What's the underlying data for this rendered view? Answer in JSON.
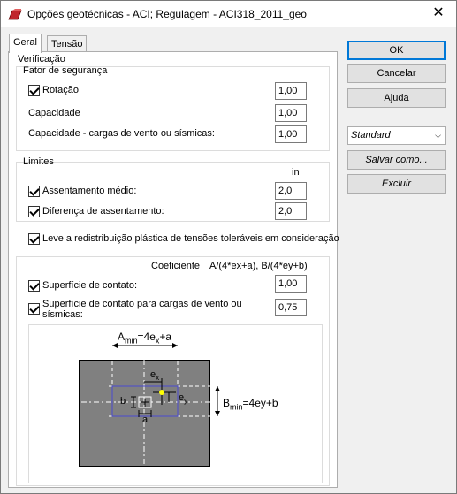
{
  "window": {
    "title": "Opções geotécnicas - ACI;  Regulagem - ACI318_2011_geo",
    "close": "✕"
  },
  "tabs": [
    {
      "label": "Geral",
      "active": true
    },
    {
      "label": "Tensão",
      "active": false
    }
  ],
  "verificacao": {
    "title": "Verificação",
    "fator": {
      "title": "Fator de segurança",
      "rows": [
        {
          "label": "Rotação",
          "value": "1,00",
          "checked": true
        },
        {
          "label": "Capacidade",
          "value": "1,00"
        },
        {
          "label": "Capacidade - cargas de vento ou sísmicas:",
          "value": "1,00"
        }
      ]
    }
  },
  "limites": {
    "title": "Limites",
    "unit": "in",
    "rows": [
      {
        "label": "Assentamento médio:",
        "value": "2,0",
        "checked": true
      },
      {
        "label": "Diferença de assentamento:",
        "value": "2,0",
        "checked": true
      }
    ]
  },
  "redistribuicao": {
    "label": "Leve a redistribuição plástica de tensões toleráveis em consideração",
    "checked": true
  },
  "contato": {
    "coef_label": "Coeficiente",
    "coef_formula": "A/(4*ex+a), B/(4*ey+b)",
    "rows": [
      {
        "label": "Superfície de contato:",
        "value": "1,00",
        "checked": true
      },
      {
        "label": "Superfície de contato para cargas de vento ou sísmicas:",
        "value": "0,75",
        "checked": true
      }
    ]
  },
  "diagram": {
    "amin_label": "A",
    "amin_sub": "min",
    "amin_eq": "=4e",
    "amin_sub2": "x",
    "amin_tail": "+a",
    "bmin_label": "B",
    "bmin_sub": "min",
    "bmin_eq": "=4ey+b",
    "ex_label": "e",
    "ex_sub": "x",
    "ey_label": "e",
    "ey_sub": "y",
    "a_label": "a",
    "b_label": "b"
  },
  "buttons": {
    "ok": "OK",
    "cancel": "Cancelar",
    "help": "Ajuda",
    "save_as": "Salvar como...",
    "delete": "Excluir"
  },
  "preset": {
    "selected": "Standard"
  },
  "colors": {
    "footing_fill": "#808080",
    "inner_rect": "#4a4ad0",
    "load_point": "#ffff00",
    "ok_border": "#0078d7",
    "icon_red": "#c0262c"
  }
}
